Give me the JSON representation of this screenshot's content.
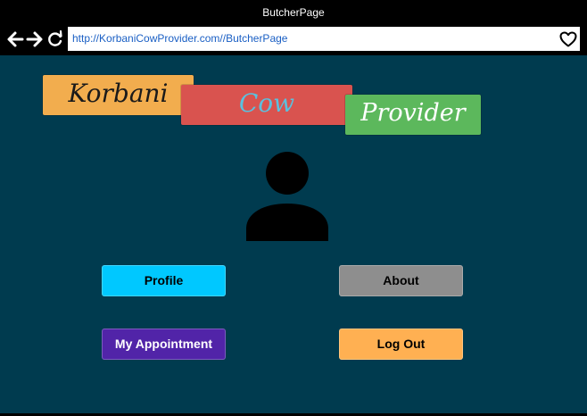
{
  "window": {
    "title": "ButcherPage"
  },
  "toolbar": {
    "back_icon": "arrow-left-icon",
    "forward_icon": "arrow-right-icon",
    "reload_icon": "reload-icon",
    "url": "http://KorbaniCowProvider.com//ButcherPage",
    "favorite_icon": "heart-icon"
  },
  "logo": {
    "word1": "Korbani",
    "word2": "Cow",
    "word3": "Provider",
    "colors": {
      "word1_bg": "#f2ad4e",
      "word2_bg": "#d9534f",
      "word3_bg": "#5cb85c"
    }
  },
  "avatar": {
    "icon": "user-icon"
  },
  "buttons": {
    "profile": "Profile",
    "about": "About",
    "appointment": "My Appointment",
    "logout": "Log Out"
  },
  "colors": {
    "page_bg": "#003b4f",
    "profile": "#00c8ff",
    "about": "#8e8e8e",
    "appointment": "#5124a8",
    "logout": "#ffb052"
  }
}
